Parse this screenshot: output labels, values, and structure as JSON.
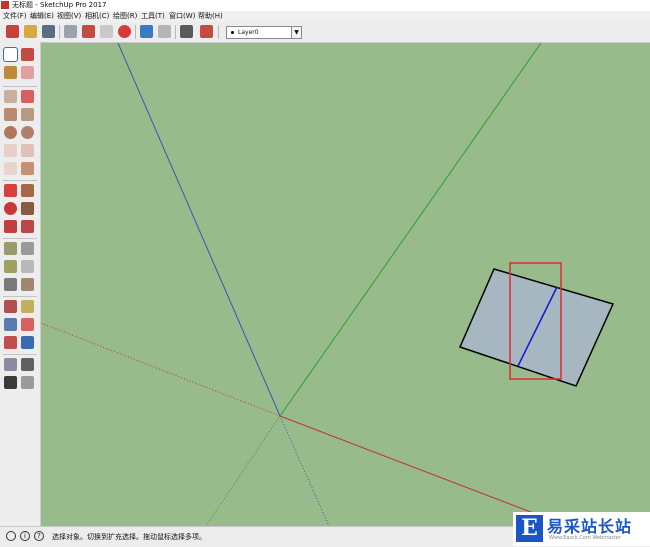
{
  "window": {
    "title": "无标题 - SketchUp Pro 2017"
  },
  "menu": {
    "items": [
      "文件(F)",
      "编辑(E)",
      "视图(V)",
      "相机(C)",
      "绘图(R)",
      "工具(T)",
      "窗口(W)",
      "帮助(H)"
    ]
  },
  "toolbar": {
    "layer_select": {
      "value": "Layer0"
    }
  },
  "status": {
    "text": "选择对象。切换到扩充选择。拖动鼠标选择多项。"
  },
  "watermark": {
    "logo_char": "E",
    "text": "易采站长站",
    "url": "Www.Easck.Com  Webmaster"
  },
  "colors": {
    "viewport_bg": "#98bb8c",
    "axis_blue": "#3b54b5",
    "axis_green": "#2ca02c",
    "axis_red": "#c0392b",
    "face_fill": "#a7b7c1",
    "selection_box": "#e02b2b"
  }
}
